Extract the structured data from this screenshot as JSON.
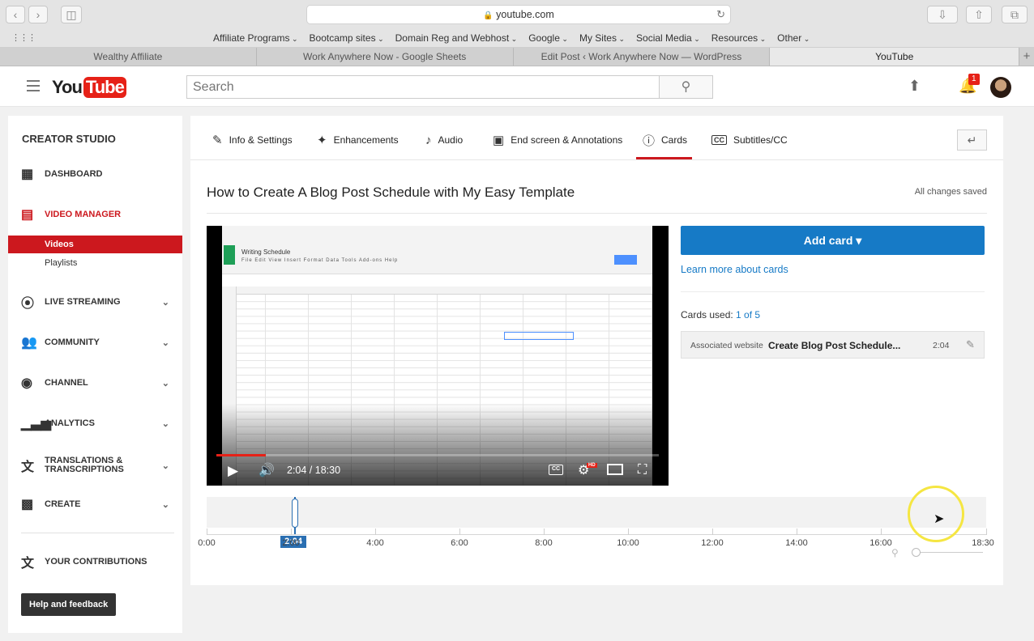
{
  "browser": {
    "url": "youtube.com",
    "bookmarks": [
      "Affiliate Programs",
      "Bootcamp sites",
      "Domain Reg and Webhost",
      "Google",
      "My Sites",
      "Social Media",
      "Resources",
      "Other"
    ],
    "tabs": [
      "Wealthy Affiliate",
      "Work Anywhere Now - Google Sheets",
      "Edit Post ‹ Work Anywhere Now — WordPress",
      "YouTube"
    ]
  },
  "header": {
    "logo_you": "You",
    "logo_tube": "Tube",
    "search_placeholder": "Search",
    "notification_count": "1"
  },
  "sidebar": {
    "title": "CREATOR STUDIO",
    "items": [
      {
        "label": "DASHBOARD"
      },
      {
        "label": "VIDEO MANAGER"
      },
      {
        "label": "LIVE STREAMING"
      },
      {
        "label": "COMMUNITY"
      },
      {
        "label": "CHANNEL"
      },
      {
        "label": "ANALYTICS"
      },
      {
        "label": "TRANSLATIONS & TRANSCRIPTIONS"
      },
      {
        "label": "CREATE"
      },
      {
        "label": "YOUR CONTRIBUTIONS"
      }
    ],
    "sub_items": [
      "Videos",
      "Playlists"
    ],
    "help_label": "Help and feedback"
  },
  "editor": {
    "tabs": [
      "Info & Settings",
      "Enhancements",
      "Audio",
      "End screen & Annotations",
      "Cards",
      "Subtitles/CC"
    ],
    "active_tab": "Cards",
    "video_title": "How to Create A Blog Post Schedule with My Easy Template",
    "save_status": "All changes saved"
  },
  "player": {
    "time": "2:04 / 18:30",
    "progress": 0.112,
    "cc_label": "CC",
    "hd_label": "HD",
    "sheet_title": "Writing Schedule",
    "sheet_menu": "File  Edit  View  Insert  Format  Data  Tools  Add-ons  Help"
  },
  "cards": {
    "add_label": "Add card ▾",
    "learn_more": "Learn more about cards",
    "used_label": "Cards used: ",
    "used_count": "1 of 5",
    "card": {
      "type": "Associated website",
      "name": "Create Blog Post Schedule...",
      "time": "2:04"
    }
  },
  "timeline": {
    "marker": "2:04",
    "ticks": [
      "0:00",
      "2:00",
      "4:00",
      "6:00",
      "8:00",
      "10:00",
      "12:00",
      "14:00",
      "16:00",
      "18:30"
    ]
  },
  "colors": {
    "accent_red": "#cc181e",
    "accent_blue": "#167ac6"
  }
}
